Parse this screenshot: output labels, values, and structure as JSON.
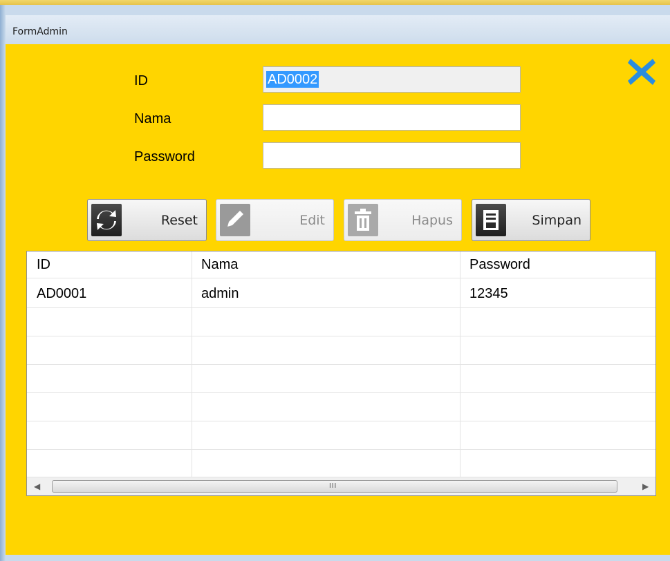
{
  "window": {
    "title": "FormAdmin"
  },
  "form": {
    "id_label": "ID",
    "id_value": "AD0002",
    "nama_label": "Nama",
    "nama_value": "",
    "password_label": "Password",
    "password_value": ""
  },
  "buttons": {
    "reset": "Reset",
    "edit": "Edit",
    "hapus": "Hapus",
    "simpan": "Simpan"
  },
  "grid": {
    "columns": [
      "ID",
      "Nama",
      "Password"
    ],
    "rows": [
      [
        "AD0001",
        "admin",
        "12345"
      ]
    ]
  },
  "colors": {
    "background": "#ffd500",
    "close_icon": "#2a8de0",
    "selection": "#3399ff"
  },
  "icons": [
    "close-icon",
    "refresh-icon",
    "pencil-icon",
    "trash-icon",
    "save-icon",
    "scroll-left-arrow",
    "scroll-right-arrow"
  ]
}
